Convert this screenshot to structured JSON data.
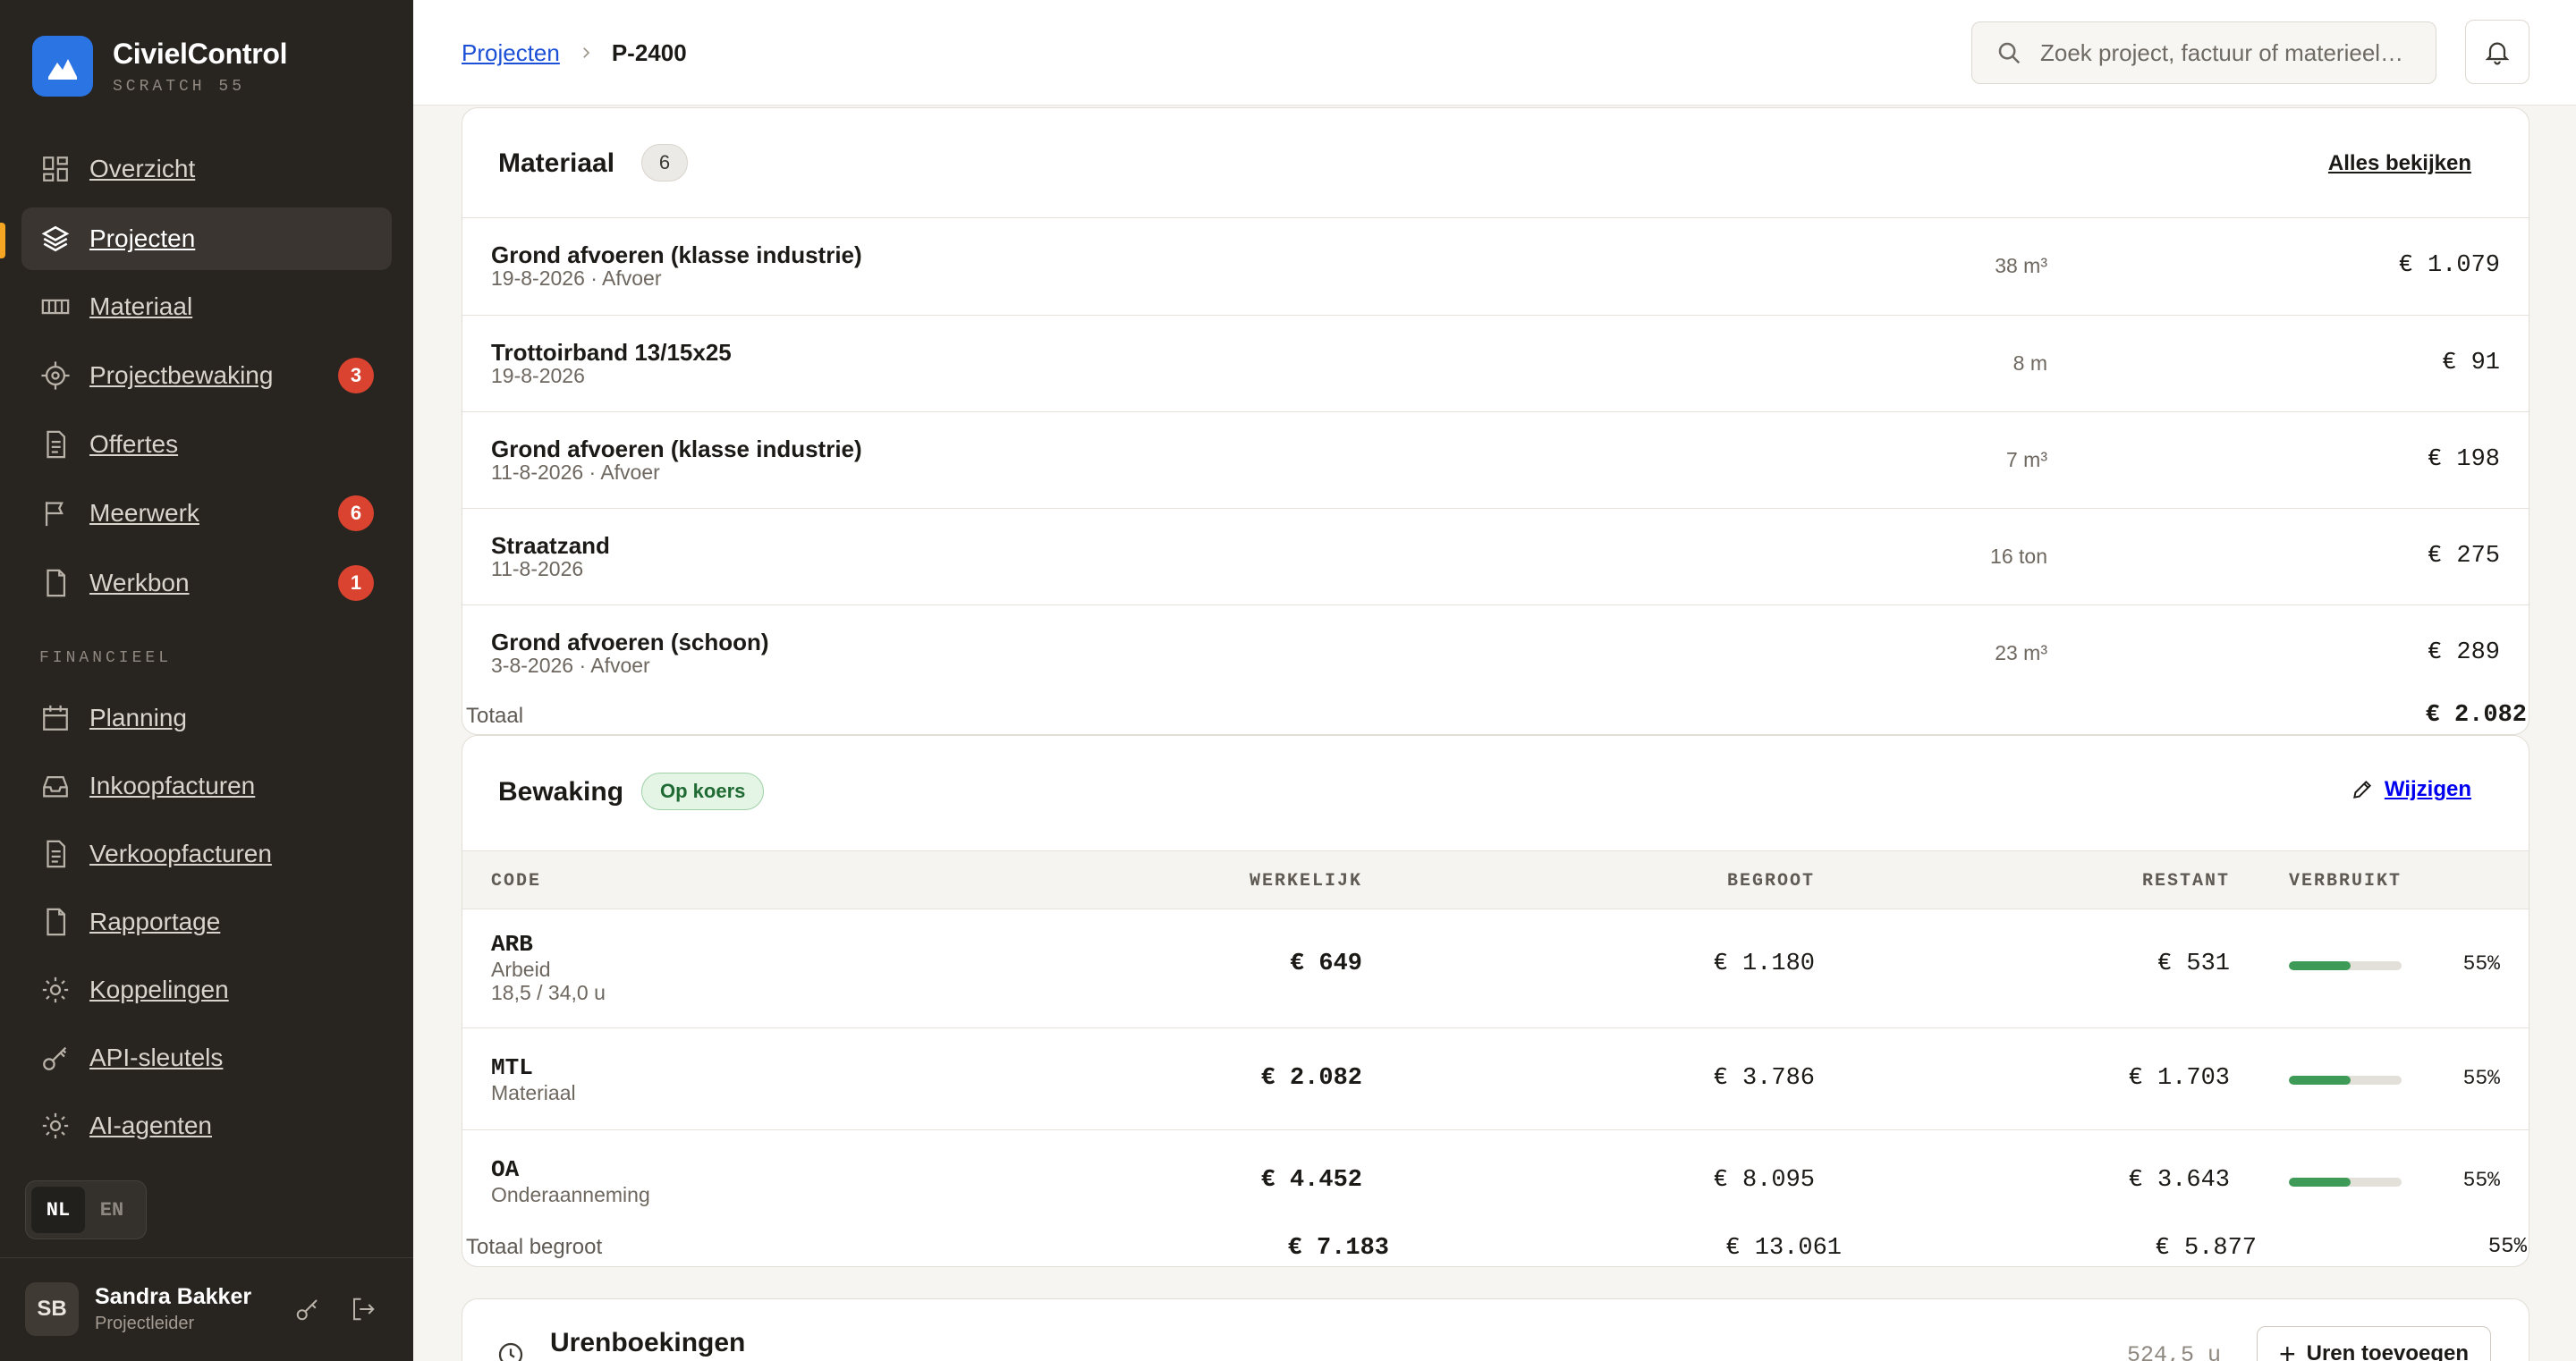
{
  "brand": {
    "name": "CivielControl",
    "sub": "SCRATCH 55"
  },
  "nav": {
    "items": [
      {
        "label": "Overzicht",
        "icon": "grid-icon",
        "badge": ""
      },
      {
        "label": "Projecten",
        "icon": "layers-icon",
        "badge": "",
        "active": true
      },
      {
        "label": "Materiaal",
        "icon": "material-icon",
        "badge": ""
      },
      {
        "label": "Projectbewaking",
        "icon": "target-icon",
        "badge": "3"
      },
      {
        "label": "Offertes",
        "icon": "document-icon",
        "badge": ""
      },
      {
        "label": "Meerwerk",
        "icon": "flag-icon",
        "badge": "6"
      },
      {
        "label": "Werkbon",
        "icon": "file-icon",
        "badge": "1"
      }
    ],
    "section_label": "FINANCIEEL",
    "finance_items": [
      {
        "label": "Planning",
        "icon": "calendar-icon"
      },
      {
        "label": "Inkoopfacturen",
        "icon": "inbox-icon"
      },
      {
        "label": "Verkoopfacturen",
        "icon": "document-icon"
      },
      {
        "label": "Rapportage",
        "icon": "file-icon"
      },
      {
        "label": "Koppelingen",
        "icon": "gear-icon"
      },
      {
        "label": "API-sleutels",
        "icon": "key-icon"
      },
      {
        "label": "AI-agenten",
        "icon": "gear-icon"
      }
    ]
  },
  "lang": {
    "nl": "NL",
    "en": "EN"
  },
  "user": {
    "initials": "SB",
    "name": "Sandra Bakker",
    "role": "Projectleider"
  },
  "breadcrumb": {
    "parent": "Projecten",
    "current": "P-2400"
  },
  "search": {
    "placeholder": "Zoek project, factuur of materieel…"
  },
  "materiaal": {
    "title": "Materiaal",
    "count": "6",
    "link": "Alles bekijken",
    "rows": [
      {
        "name": "Grond afvoeren (klasse industrie)",
        "sub": "19-8-2026 · Afvoer",
        "qty": "38 m³",
        "amount": "€ 1.079"
      },
      {
        "name": "Trottoirband 13/15x25",
        "sub": "19-8-2026",
        "qty": "8 m",
        "amount": "€ 91"
      },
      {
        "name": "Grond afvoeren (klasse industrie)",
        "sub": "11-8-2026 · Afvoer",
        "qty": "7 m³",
        "amount": "€ 198"
      },
      {
        "name": "Straatzand",
        "sub": "11-8-2026",
        "qty": "16 ton",
        "amount": "€ 275"
      },
      {
        "name": "Grond afvoeren (schoon)",
        "sub": "3-8-2026 · Afvoer",
        "qty": "23 m³",
        "amount": "€ 289"
      }
    ],
    "total_label": "Totaal",
    "total_value": "€ 2.082"
  },
  "bewaking": {
    "title": "Bewaking",
    "status": "Op koers",
    "edit": "Wijzigen",
    "headers": {
      "code": "CODE",
      "begroot": "BEGROOT",
      "werkelijk": "WERKELIJK",
      "restant": "RESTANT",
      "verbruikt": "VERBRUIKT"
    },
    "rows": [
      {
        "code": "ARB",
        "name": "Arbeid",
        "extra": "18,5 / 34,0 u",
        "begroot": "€ 1.180",
        "werkelijk": "€ 649",
        "restant": "€ 531",
        "pct": "55%",
        "fill": 0.55
      },
      {
        "code": "MTL",
        "name": "Materiaal",
        "extra": "",
        "begroot": "€ 3.786",
        "werkelijk": "€ 2.082",
        "restant": "€ 1.703",
        "pct": "55%",
        "fill": 0.55
      },
      {
        "code": "OA",
        "name": "Onderaanneming",
        "extra": "",
        "begroot": "€ 8.095",
        "werkelijk": "€ 4.452",
        "restant": "€ 3.643",
        "pct": "55%",
        "fill": 0.55
      }
    ],
    "total": {
      "label": "Totaal begroot",
      "begroot": "€ 13.061",
      "werkelijk": "€ 7.183",
      "restant": "€ 5.877",
      "pct": "55%"
    }
  },
  "uren": {
    "title": "Urenboekingen",
    "hours": "524,5 u",
    "add": "Uren toevoegen"
  },
  "colors": {
    "accent": "#f5a623",
    "brand": "#2b74e4",
    "sidebar": "#282420",
    "badge": "#d9432f",
    "progress": "#3d9a57"
  }
}
